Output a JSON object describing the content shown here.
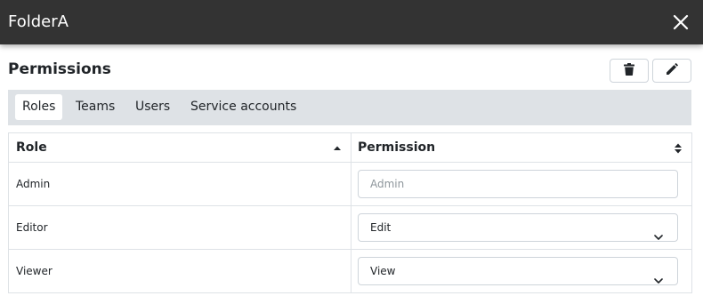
{
  "window": {
    "title": "FolderA",
    "close_icon": "close-icon"
  },
  "permissions": {
    "heading": "Permissions",
    "actions": [
      {
        "name": "delete",
        "icon": "trash-icon"
      },
      {
        "name": "edit",
        "icon": "pencil-icon"
      }
    ]
  },
  "tabs": [
    {
      "label": "Roles",
      "active": true
    },
    {
      "label": "Teams",
      "active": false
    },
    {
      "label": "Users",
      "active": false
    },
    {
      "label": "Service accounts",
      "active": false
    }
  ],
  "table": {
    "columns": [
      {
        "label": "Role",
        "sort": "ascending"
      },
      {
        "label": "Permission",
        "sort": "none"
      }
    ],
    "rows": [
      {
        "role": "Admin",
        "permission": "Admin",
        "editable": false
      },
      {
        "role": "Editor",
        "permission": "Edit",
        "editable": true
      },
      {
        "role": "Viewer",
        "permission": "View",
        "editable": true
      }
    ]
  },
  "colors": {
    "titlebar_bg": "#333333",
    "tabbar_bg": "#dee2e6",
    "border": "#dee2e6"
  }
}
